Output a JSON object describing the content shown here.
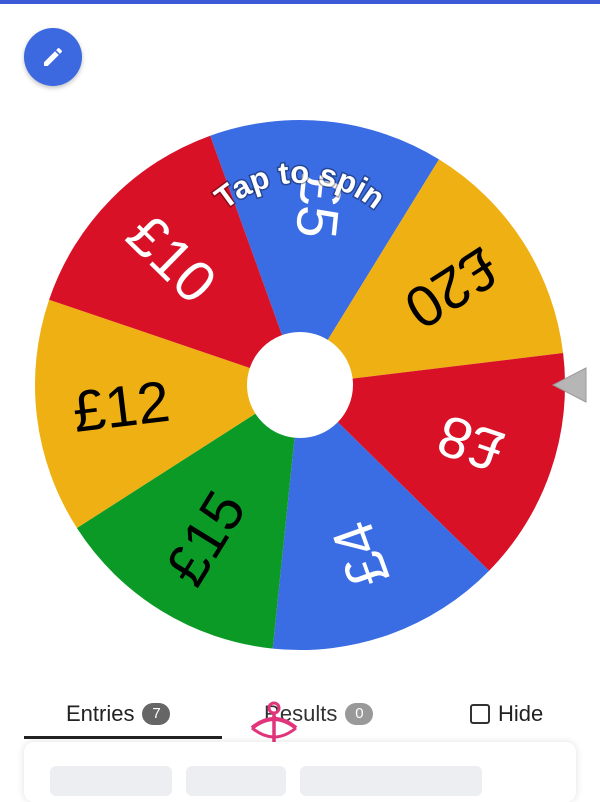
{
  "toolbar": {
    "edit_icon": "pencil-icon",
    "accent": "#3c68e0"
  },
  "wheel": {
    "center_label": "Tap to spin",
    "pointer_icon": "pointer-triangle-icon",
    "segments": [
      {
        "label": "£5",
        "color": "#3a6ce3",
        "text_color": "#ffffff"
      },
      {
        "label": "£20",
        "color": "#efb013",
        "text_color": "#000000"
      },
      {
        "label": "£8",
        "color": "#d81127",
        "text_color": "#ffffff"
      },
      {
        "label": "£4",
        "color": "#3a6ce3",
        "text_color": "#ffffff"
      },
      {
        "label": "£15",
        "color": "#0b9a26",
        "text_color": "#000000"
      },
      {
        "label": "£12",
        "color": "#efb013",
        "text_color": "#000000"
      },
      {
        "label": "£10",
        "color": "#d81127",
        "text_color": "#ffffff"
      }
    ]
  },
  "tabs": [
    {
      "label": "Entries",
      "count": "7"
    },
    {
      "label": "Results",
      "count": "0"
    },
    {
      "label": "Hide"
    }
  ]
}
